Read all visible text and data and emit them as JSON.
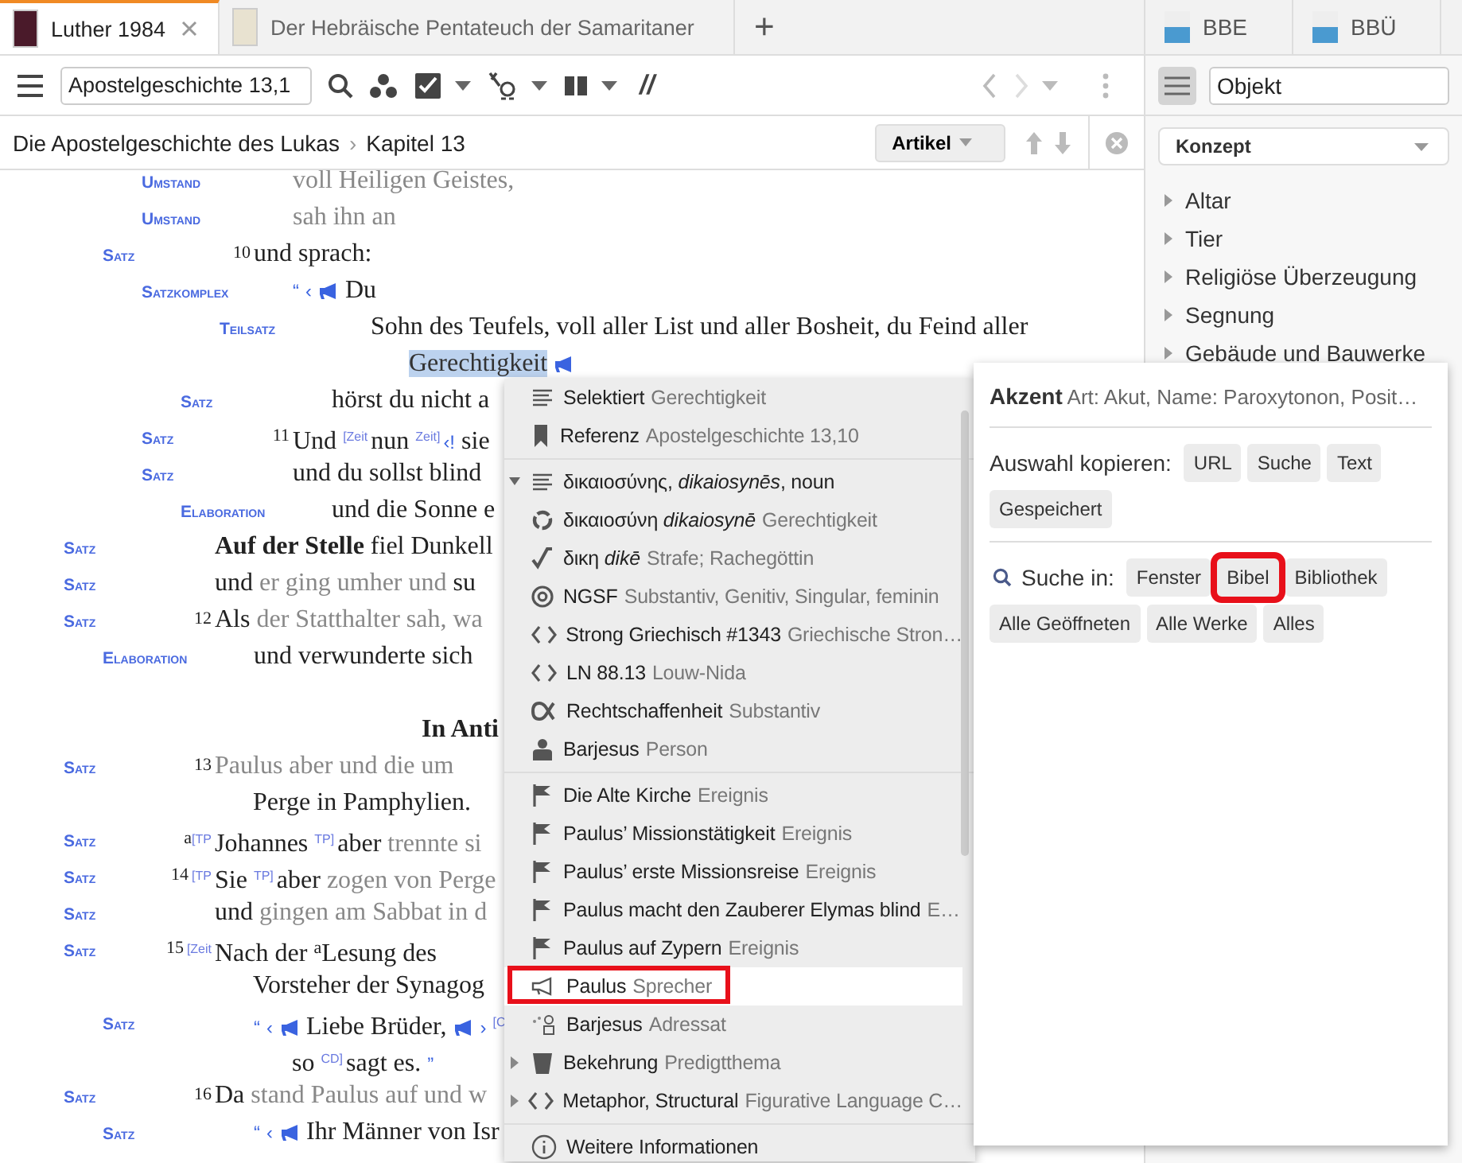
{
  "tabs": [
    {
      "title": "Luther 1984",
      "selected": true
    },
    {
      "title": "Der Hebräische Pentateuch der Samaritaner",
      "selected": false
    }
  ],
  "new_tab": "+",
  "toolbar": {
    "reference": "Apostelgeschichte 13,1",
    "parallel": "//"
  },
  "breadcrumb": [
    "Die Apostelgeschichte des Lukas",
    "Kapitel 13"
  ],
  "breadcrumb_separator": "›",
  "view_button": "Artikel",
  "outline": [
    {
      "kind": "group",
      "children": [
        {
          "kind": "group",
          "children": [
            {
              "kind": "clause",
              "label": "Umstand",
              "lines": [
                [
                  {
                    "kind": "muted",
                    "text": "voll Heiligen Geistes,"
                  }
                ]
              ]
            },
            {
              "kind": "clause",
              "label": "Umstand",
              "lines": [
                [
                  {
                    "kind": "muted",
                    "text": "sah ihn an"
                  }
                ]
              ]
            }
          ]
        },
        {
          "kind": "clause",
          "label": "Satz",
          "lines": [
            [
              {
                "kind": "verse",
                "text": "10"
              },
              {
                "kind": "plain",
                "text": "und sprach:"
              }
            ]
          ],
          "children": [
            {
              "kind": "clause",
              "label": "Satzkomplex",
              "lines": [
                [
                  {
                    "kind": "mark",
                    "text": "“"
                  },
                  {
                    "kind": "mark",
                    "text": "‹"
                  },
                  {
                    "kind": "speaker"
                  },
                  {
                    "kind": "plain",
                    "text": "Du"
                  }
                ]
              ],
              "children": [
                {
                  "kind": "group",
                  "children": [
                    {
                      "kind": "clause",
                      "label": "Teilsatz",
                      "lines": [
                        [
                          {
                            "kind": "plain",
                            "text": "Sohn des Teufels, voll aller List und aller Bosheit, du Feind aller"
                          }
                        ],
                        [
                          {
                            "kind": "highlight",
                            "text": "Gerechtigkeit"
                          },
                          {
                            "kind": "speaker"
                          }
                        ]
                      ]
                    }
                  ]
                },
                {
                  "kind": "clause",
                  "label": "Satz",
                  "lines": [
                    [
                      {
                        "kind": "plain",
                        "text": "hörst du nicht a"
                      }
                    ]
                  ]
                }
              ]
            },
            {
              "kind": "clause",
              "label": "Satz",
              "lines": [
                [
                  {
                    "kind": "verse",
                    "text": "11"
                  },
                  {
                    "kind": "plain",
                    "text": "Und"
                  },
                  {
                    "kind": "tag",
                    "text": "[Zeit"
                  },
                  {
                    "kind": "plain",
                    "text": "nun"
                  },
                  {
                    "kind": "tag",
                    "text": "Zeit]"
                  },
                  {
                    "kind": "mark",
                    "text": "‹!"
                  },
                  {
                    "kind": "plain",
                    "text": "sie"
                  }
                ]
              ]
            },
            {
              "kind": "clause",
              "label": "Satz",
              "lines": [
                [
                  {
                    "kind": "plain",
                    "text": "und du sollst blind"
                  }
                ]
              ],
              "children": [
                {
                  "kind": "clause",
                  "label": "Elaboration",
                  "lines": [
                    [
                      {
                        "kind": "plain",
                        "text": "und die Sonne e"
                      }
                    ]
                  ]
                }
              ]
            }
          ]
        }
      ]
    },
    {
      "kind": "clause",
      "label": "Satz",
      "lines": [
        [
          {
            "kind": "bold",
            "text": "Auf der Stelle"
          },
          {
            "kind": "plain",
            "text": "fiel Dunkell"
          }
        ]
      ]
    },
    {
      "kind": "clause",
      "label": "Satz",
      "lines": [
        [
          {
            "kind": "plain",
            "text": "und"
          },
          {
            "kind": "muted",
            "text": "er ging umher und"
          },
          {
            "kind": "plain",
            "text": "su"
          }
        ]
      ]
    },
    {
      "kind": "clause",
      "label": "Satz",
      "lines": [
        [
          {
            "kind": "verse",
            "text": "12"
          },
          {
            "kind": "plain",
            "text": "Als"
          },
          {
            "kind": "muted",
            "text": "der Statthalter sah, wa"
          }
        ]
      ],
      "children": [
        {
          "kind": "clause",
          "label": "Elaboration",
          "lines": [
            [
              {
                "kind": "plain",
                "text": "und verwunderte sich"
              }
            ]
          ]
        }
      ]
    },
    {
      "kind": "heading",
      "text": "In Anti"
    },
    {
      "kind": "clause",
      "label": "Satz",
      "lines": [
        [
          {
            "kind": "verse",
            "text": "13"
          },
          {
            "kind": "muted",
            "text": "Paulus aber und die um"
          }
        ],
        [
          {
            "kind": "plain",
            "text": "Perge in Pamphylien."
          }
        ]
      ]
    },
    {
      "kind": "clause",
      "label": "Satz",
      "lines": [
        [
          {
            "kind": "note",
            "text": "a"
          },
          {
            "kind": "tag",
            "text": "[TP"
          },
          {
            "kind": "plain",
            "text": "Johannes"
          },
          {
            "kind": "tag",
            "text": "TP]"
          },
          {
            "kind": "plain",
            "text": "aber"
          },
          {
            "kind": "muted",
            "text": "trennte si"
          }
        ]
      ]
    },
    {
      "kind": "clause",
      "label": "Satz",
      "lines": [
        [
          {
            "kind": "verse",
            "text": "14"
          },
          {
            "kind": "tag",
            "text": "[TP"
          },
          {
            "kind": "plain",
            "text": "Sie"
          },
          {
            "kind": "tag",
            "text": "TP]"
          },
          {
            "kind": "plain",
            "text": "aber"
          },
          {
            "kind": "muted",
            "text": "zogen von Perge"
          }
        ]
      ]
    },
    {
      "kind": "clause",
      "label": "Satz",
      "lines": [
        [
          {
            "kind": "plain",
            "text": "und"
          },
          {
            "kind": "muted",
            "text": "gingen am Sabbat in d"
          }
        ]
      ]
    },
    {
      "kind": "clause",
      "label": "Satz",
      "lines": [
        [
          {
            "kind": "verse",
            "text": "15"
          },
          {
            "kind": "tag",
            "text": "[Zeit"
          },
          {
            "kind": "plain",
            "text": "Nach der"
          },
          {
            "kind": "note",
            "text": "a"
          },
          {
            "kind": "plain",
            "text": "Lesung des"
          }
        ],
        [
          {
            "kind": "plain",
            "text": "Vorsteher der Synagog"
          }
        ]
      ],
      "children": [
        {
          "kind": "clause",
          "label": "Satz",
          "lines": [
            [
              {
                "kind": "mark",
                "text": "“"
              },
              {
                "kind": "mark",
                "text": "‹"
              },
              {
                "kind": "speaker"
              },
              {
                "kind": "plain",
                "text": "Liebe Brüder,"
              },
              {
                "kind": "speaker"
              },
              {
                "kind": "mark",
                "text": "›"
              },
              {
                "kind": "tag",
                "text": "[C"
              }
            ],
            [
              {
                "kind": "plain",
                "text": "so"
              },
              {
                "kind": "tag",
                "text": "CD]"
              },
              {
                "kind": "plain",
                "text": "sagt es."
              },
              {
                "kind": "mark",
                "text": "”"
              }
            ]
          ]
        }
      ]
    },
    {
      "kind": "clause",
      "label": "Satz",
      "lines": [
        [
          {
            "kind": "verse",
            "text": "16"
          },
          {
            "kind": "plain",
            "text": "Da"
          },
          {
            "kind": "muted",
            "text": "stand Paulus auf und w"
          }
        ]
      ],
      "children": [
        {
          "kind": "clause",
          "label": "Satz",
          "lines": [
            [
              {
                "kind": "mark",
                "text": "“"
              },
              {
                "kind": "mark",
                "text": "‹"
              },
              {
                "kind": "speaker"
              },
              {
                "kind": "plain",
                "text": "Ihr Männer von Isr"
              }
            ]
          ]
        }
      ]
    }
  ],
  "context_menu": {
    "groups": [
      [
        {
          "kind": "lines",
          "label": "Selektiert",
          "detail": "Gerechtigkeit",
          "hovered": false,
          "outlined": false
        },
        {
          "kind": "bookmark",
          "label": "Referenz",
          "detail": "Apostelgeschichte 13,10",
          "hovered": false,
          "outlined": false
        }
      ],
      [
        {
          "kind": "lines",
          "label": "δικαιοσύνης, *dikaiosynēs*, noun",
          "expanded": true,
          "hovered": false,
          "outlined": false
        },
        {
          "kind": "ring",
          "label": "δικαιοσύνη *dikaiosynē*",
          "detail": "Gerechtigkeit",
          "hovered": false,
          "outlined": false
        },
        {
          "kind": "root",
          "label": "δικη *dikē*",
          "detail": "Strafe; Rachegöttin",
          "hovered": false,
          "outlined": false
        },
        {
          "kind": "at",
          "label": "NGSF",
          "detail": "Substantiv, Genitiv, Singular, feminin",
          "hovered": false,
          "outlined": false
        },
        {
          "kind": "code",
          "label": "Strong Griechisch #1343",
          "detail": "Griechische Stron…",
          "hovered": false,
          "outlined": false
        },
        {
          "kind": "code",
          "label": "LN 88.13",
          "detail": "Louw-Nida",
          "hovered": false,
          "outlined": false
        },
        {
          "kind": "alpha",
          "label": "Rechtschaffenheit",
          "detail": "Substantiv",
          "hovered": false,
          "outlined": false
        },
        {
          "kind": "person",
          "label": "Barjesus",
          "detail": "Person",
          "hovered": false,
          "outlined": false
        }
      ],
      [
        {
          "kind": "flag",
          "label": "Die Alte Kirche",
          "detail": "Ereignis",
          "hovered": false,
          "outlined": false
        },
        {
          "kind": "flag",
          "label": "Paulus’ Missionstätigkeit",
          "detail": "Ereignis",
          "hovered": false,
          "outlined": false
        },
        {
          "kind": "flag",
          "label": "Paulus’ erste Missionsreise",
          "detail": "Ereignis",
          "hovered": false,
          "outlined": false
        },
        {
          "kind": "flag",
          "label": "Paulus macht den Zauberer Elymas blind",
          "detail": "E…",
          "hovered": false,
          "outlined": false
        },
        {
          "kind": "flag",
          "label": "Paulus auf Zypern",
          "detail": "Ereignis",
          "hovered": false,
          "outlined": false
        },
        {
          "kind": "megaphone",
          "label": "Paulus",
          "detail": "Sprecher",
          "hovered": true,
          "outlined": true
        },
        {
          "kind": "addressee",
          "label": "Barjesus",
          "detail": "Adressat",
          "hovered": false,
          "outlined": false
        },
        {
          "kind": "book",
          "label": "Bekehrung",
          "detail": "Predigtthema",
          "expanded": false,
          "hovered": false,
          "outlined": false
        },
        {
          "kind": "code",
          "label": "Metaphor, Structural",
          "detail": "Figurative Language C…",
          "expanded": false,
          "hovered": false,
          "outlined": false
        }
      ],
      [
        {
          "kind": "info",
          "label": "Weitere Informationen",
          "hovered": false,
          "outlined": false
        }
      ]
    ]
  },
  "info_panel": {
    "title": "**Akzent** Art: Akut, Name: Paroxytonon, Posit…",
    "copy_label": "Auswahl kopieren:",
    "copy_buttons": [
      {
        "label": "URL",
        "outlined": false
      },
      {
        "label": "Suche",
        "outlined": false
      },
      {
        "label": "Text",
        "outlined": false
      },
      {
        "label": "Gespeichert",
        "outlined": false
      }
    ],
    "search_label": "Suche in:",
    "search_buttons": [
      {
        "label": "Fenster",
        "outlined": false
      },
      {
        "label": "Bibel",
        "outlined": true
      },
      {
        "label": "Bibliothek",
        "outlined": false
      },
      {
        "label": "Alle Geöffneten",
        "outlined": false
      },
      {
        "label": "Alle Werke",
        "outlined": false
      },
      {
        "label": "Alles",
        "outlined": false
      }
    ]
  },
  "sidebar": {
    "tabs": [
      {
        "title": "BBE"
      },
      {
        "title": "BBÜ"
      }
    ],
    "search": "Objekt",
    "filter": "Konzept",
    "items": [
      {
        "label": "Altar",
        "expanded": false
      },
      {
        "label": "Tier",
        "expanded": false
      },
      {
        "label": "Religiöse Überzeugung",
        "expanded": false
      },
      {
        "label": "Segnung",
        "expanded": false
      },
      {
        "label": "Gebäude und Bauwerke",
        "expanded": false
      }
    ]
  }
}
